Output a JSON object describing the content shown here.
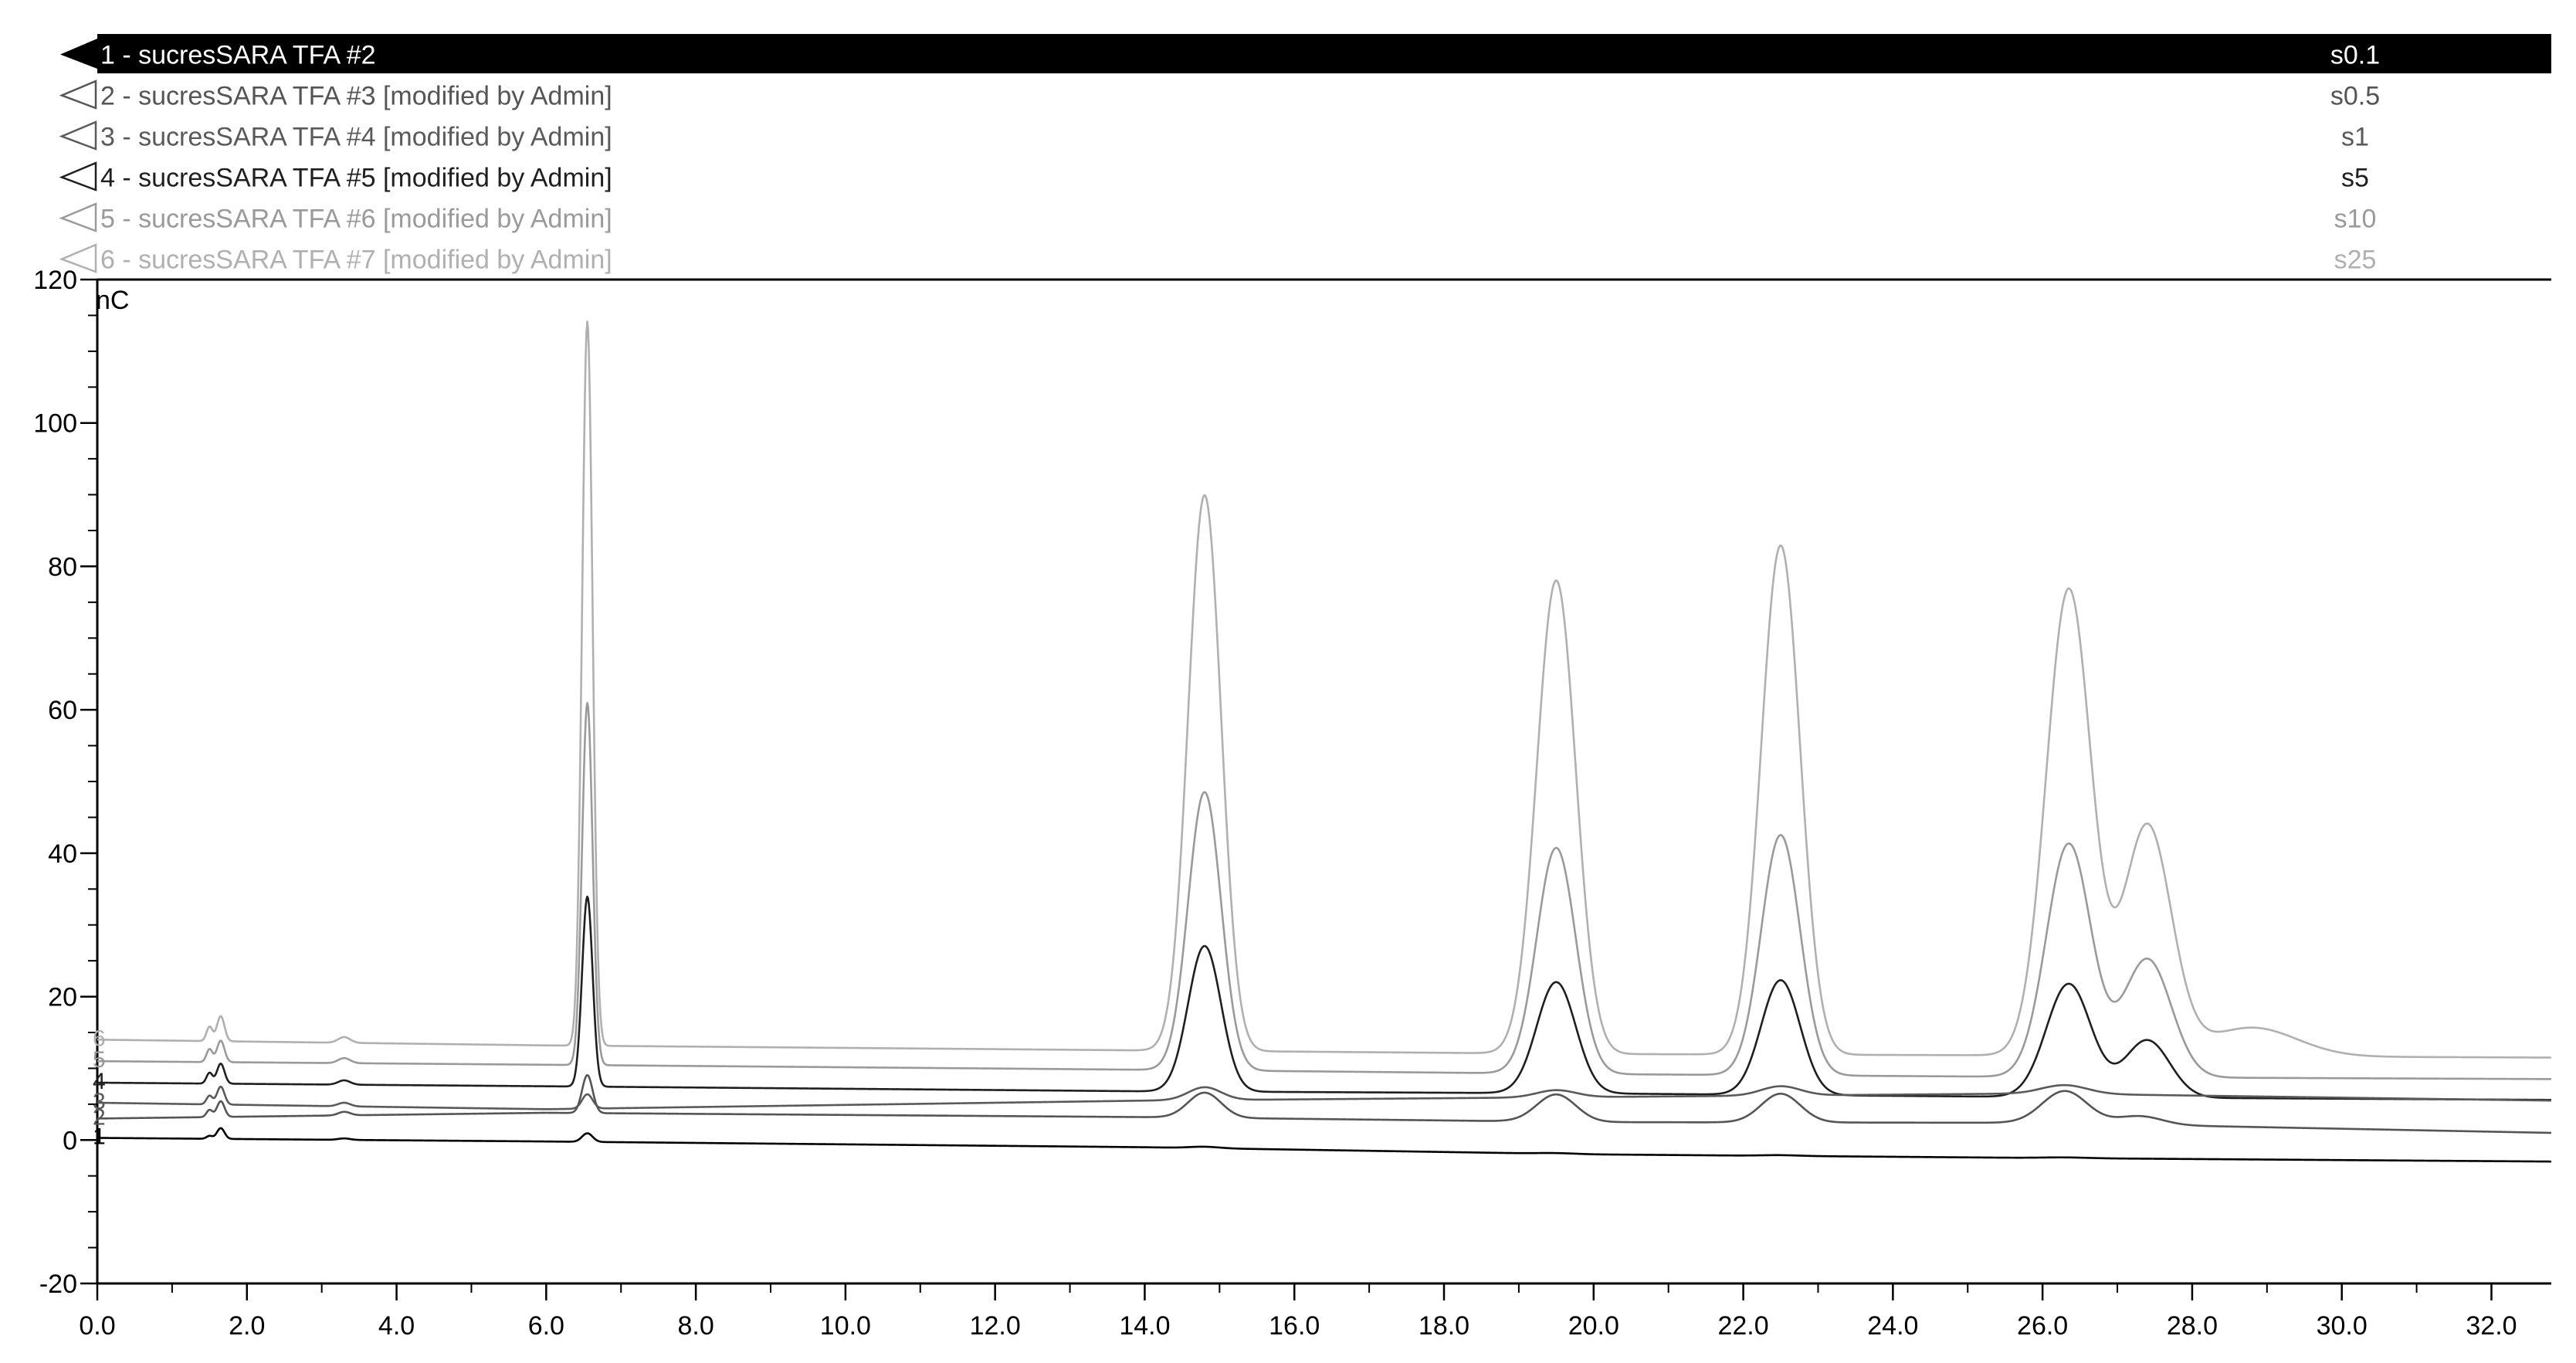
{
  "chart_data": {
    "type": "line",
    "yunit": "nC",
    "xlim": [
      0,
      32.8
    ],
    "ylim": [
      -20,
      120
    ],
    "xticks": [
      "0.0",
      "2.0",
      "4.0",
      "6.0",
      "8.0",
      "10.0",
      "12.0",
      "14.0",
      "16.0",
      "18.0",
      "20.0",
      "22.0",
      "24.0",
      "26.0",
      "28.0",
      "30.0",
      "32.0"
    ],
    "yticks": [
      "-20",
      "0",
      "20",
      "40",
      "60",
      "80",
      "100",
      "120"
    ],
    "series": [
      {
        "name": "1 - sucresSARA TFA #2",
        "short": "1",
        "sample": "s0.1",
        "color": "#000000",
        "highlighted": true,
        "baseline": [
          [
            0,
            0.3
          ],
          [
            6.0,
            -0.2
          ],
          [
            14.0,
            -1.0
          ],
          [
            20.0,
            -2.0
          ],
          [
            26.0,
            -2.5
          ],
          [
            32.8,
            -3.0
          ]
        ],
        "peaks": [
          [
            1.5,
            0.4,
            0.04
          ],
          [
            1.65,
            1.5,
            0.05
          ],
          [
            3.3,
            0.2,
            0.08
          ],
          [
            6.55,
            1.2,
            0.07
          ],
          [
            14.8,
            0.2,
            0.2
          ],
          [
            19.5,
            0.1,
            0.25
          ],
          [
            22.5,
            0.1,
            0.25
          ],
          [
            26.3,
            0.1,
            0.3
          ]
        ]
      },
      {
        "name": "2 - sucresSARA TFA #3 [modified by Admin]",
        "short": "2",
        "sample": "s0.5",
        "color": "#555555",
        "highlighted": false,
        "baseline": [
          [
            0,
            3.0
          ],
          [
            6.0,
            3.8
          ],
          [
            14.0,
            3.2
          ],
          [
            20.0,
            2.5
          ],
          [
            26.0,
            2.4
          ],
          [
            32.8,
            1.0
          ]
        ],
        "peaks": [
          [
            1.5,
            1.0,
            0.04
          ],
          [
            1.65,
            2.2,
            0.05
          ],
          [
            3.3,
            0.5,
            0.08
          ],
          [
            6.55,
            5.3,
            0.07
          ],
          [
            14.8,
            3.5,
            0.22
          ],
          [
            19.5,
            3.8,
            0.26
          ],
          [
            22.5,
            4.0,
            0.26
          ],
          [
            26.3,
            4.5,
            0.3
          ],
          [
            27.3,
            1.2,
            0.3
          ]
        ]
      },
      {
        "name": "3 - sucresSARA TFA #4 [modified by Admin]",
        "short": "3",
        "sample": "s1",
        "color": "#5a5a5a",
        "highlighted": false,
        "baseline": [
          [
            0,
            5.2
          ],
          [
            6.0,
            4.3
          ],
          [
            14.0,
            5.5
          ],
          [
            20.0,
            6.0
          ],
          [
            26.0,
            6.5
          ],
          [
            32.8,
            5.5
          ]
        ],
        "peaks": [
          [
            1.5,
            1.2,
            0.04
          ],
          [
            1.65,
            2.5,
            0.05
          ],
          [
            3.3,
            0.5,
            0.08
          ],
          [
            6.55,
            2.0,
            0.07
          ],
          [
            14.8,
            1.8,
            0.22
          ],
          [
            19.5,
            1.0,
            0.26
          ],
          [
            22.5,
            1.3,
            0.26
          ],
          [
            26.3,
            1.2,
            0.3
          ]
        ]
      },
      {
        "name": "4 - sucresSARA TFA #5 [modified by Admin]",
        "short": "4",
        "sample": "s5",
        "color": "#1f1f1f",
        "highlighted": false,
        "baseline": [
          [
            0,
            8.0
          ],
          [
            6.0,
            7.5
          ],
          [
            14.0,
            6.8
          ],
          [
            20.0,
            6.5
          ],
          [
            26.0,
            6.0
          ],
          [
            32.8,
            5.6
          ]
        ],
        "peaks": [
          [
            1.5,
            1.5,
            0.04
          ],
          [
            1.65,
            2.8,
            0.05
          ],
          [
            3.3,
            0.6,
            0.08
          ],
          [
            6.55,
            26.5,
            0.07
          ],
          [
            14.8,
            20.3,
            0.22
          ],
          [
            19.5,
            15.5,
            0.26
          ],
          [
            22.5,
            16.0,
            0.26
          ],
          [
            26.35,
            15.8,
            0.3
          ],
          [
            27.4,
            8.0,
            0.3
          ]
        ]
      },
      {
        "name": "5 - sucresSARA TFA #6 [modified by Admin]",
        "short": "5",
        "sample": "s10",
        "color": "#9a9a9a",
        "highlighted": false,
        "baseline": [
          [
            0,
            11.0
          ],
          [
            6.0,
            10.5
          ],
          [
            14.0,
            9.8
          ],
          [
            20.0,
            9.2
          ],
          [
            26.0,
            8.8
          ],
          [
            32.8,
            8.5
          ]
        ],
        "peaks": [
          [
            1.5,
            1.8,
            0.04
          ],
          [
            1.65,
            3.0,
            0.05
          ],
          [
            3.3,
            0.7,
            0.08
          ],
          [
            6.55,
            50.5,
            0.07
          ],
          [
            14.8,
            38.8,
            0.22
          ],
          [
            19.5,
            31.5,
            0.26
          ],
          [
            22.5,
            33.5,
            0.26
          ],
          [
            26.35,
            32.5,
            0.3
          ],
          [
            27.4,
            16.5,
            0.32
          ]
        ]
      },
      {
        "name": "6 - sucresSARA TFA #7 [modified by Admin]",
        "short": "6",
        "sample": "s25",
        "color": "#b0b0b0",
        "highlighted": false,
        "baseline": [
          [
            0,
            14.0
          ],
          [
            6.0,
            13.2
          ],
          [
            14.0,
            12.5
          ],
          [
            20.0,
            12.0
          ],
          [
            26.0,
            11.8
          ],
          [
            32.8,
            11.5
          ]
        ],
        "peaks": [
          [
            1.5,
            2.0,
            0.04
          ],
          [
            1.65,
            3.5,
            0.05
          ],
          [
            3.3,
            0.8,
            0.08
          ],
          [
            6.55,
            101.0,
            0.07
          ],
          [
            14.8,
            77.5,
            0.22
          ],
          [
            19.5,
            66.0,
            0.26
          ],
          [
            22.5,
            71.0,
            0.26
          ],
          [
            26.35,
            65.0,
            0.3
          ],
          [
            27.4,
            32.0,
            0.32
          ],
          [
            28.8,
            4.0,
            0.6
          ]
        ]
      }
    ]
  }
}
